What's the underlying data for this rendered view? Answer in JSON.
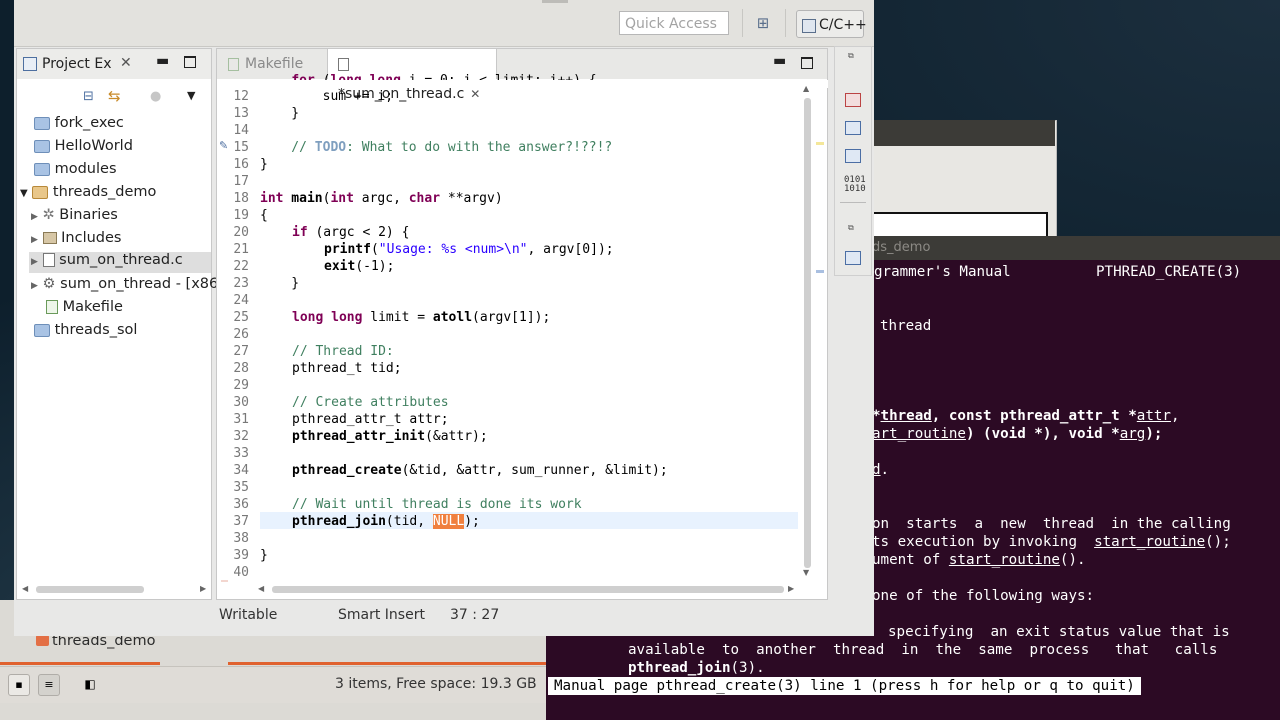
{
  "eclipse": {
    "quick_access_placeholder": "Quick Access",
    "perspective_label": "C/C++",
    "project_explorer": {
      "title": "Project Ex",
      "items": [
        {
          "label": "fork_exec"
        },
        {
          "label": "HelloWorld"
        },
        {
          "label": "modules"
        },
        {
          "label": "threads_demo"
        },
        {
          "label": "Binaries"
        },
        {
          "label": "Includes"
        },
        {
          "label": "sum_on_thread.c"
        },
        {
          "label": "sum_on_thread - [x86_"
        },
        {
          "label": "Makefile"
        },
        {
          "label": "threads_sol"
        }
      ]
    },
    "editor": {
      "tabs": [
        {
          "label": "Makefile"
        },
        {
          "label": "*sum_on_thread.c"
        }
      ],
      "line_numbers": [
        "12",
        "13",
        "14",
        "15",
        "16",
        "17",
        "18",
        "19",
        "20",
        "21",
        "22",
        "23",
        "24",
        "25",
        "26",
        "27",
        "28",
        "29",
        "30",
        "31",
        "32",
        "33",
        "34",
        "35",
        "36",
        "37",
        "38",
        "39",
        "40"
      ],
      "code": {
        "l12": "        sum += i;",
        "l13": "    }",
        "l15_prefix": "    // ",
        "l15_todo": "TODO",
        "l15_rest": ": What to do with the answer?!??!?",
        "l16": "}",
        "l18_kw1": "int",
        "l18_fn": " main",
        "l18_a": "(",
        "l18_kw2": "int",
        "l18_b": " argc, ",
        "l18_kw3": "char",
        "l18_c": " **argv)",
        "l19": "{",
        "l20_kw": "if",
        "l20_rest": " (argc < 2) {",
        "l21_fn": "printf",
        "l21_a": "(",
        "l21_str": "\"Usage: %s <num>\\n\"",
        "l21_rest": ", argv[0]);",
        "l22_fn": "exit",
        "l22_rest": "(-1);",
        "l23": "    }",
        "l25_kw": "long long",
        "l25_a": " limit = ",
        "l25_fn": "atoll",
        "l25_rest": "(argv[1]);",
        "l27": "// Thread ID:",
        "l28": "pthread_t tid;",
        "l30": "// Create attributes",
        "l31": "pthread_attr_t attr;",
        "l32_fn": "pthread_attr_init",
        "l32_rest": "(&attr);",
        "l34_fn": "pthread_create",
        "l34_rest": "(&tid, &attr, sum_runner, &limit);",
        "l36": "// Wait until thread is done its work",
        "l37_fn": "pthread_join",
        "l37_a": "(tid, ",
        "l37_sel": "NULL",
        "l37_rest": ");",
        "l39": "}"
      }
    },
    "status": {
      "mode": "Writable",
      "insert": "Smart Insert",
      "position": "37 : 27"
    }
  },
  "file_manager": {
    "item": "threads_demo",
    "status": "3 items, Free space: 19.3 GB"
  },
  "terminal": {
    "title": "ds_demo",
    "lines": {
      "header_left": "grammer's Manual",
      "header_right": "PTHREAD_CREATE(3)",
      "name": "thread",
      "syn1_a": "*",
      "syn1_b": "thread",
      "syn1_c": ", const pthread_attr_t *",
      "syn1_d": "attr",
      "syn1_e": ",",
      "syn2_a": "art_routine",
      "syn2_b": ") (void *), void *",
      "syn2_c": "arg",
      "syn2_d": ");",
      "syn3": "d",
      "syn3_dot": ".",
      "d1": "on  starts  a  new  thread  in the calling",
      "d2_a": "ts execution by invoking  ",
      "d2_b": "start_routine",
      "d2_c": "();",
      "d3_a": "ument of ",
      "d3_b": "start_routine",
      "d3_c": "().",
      "d4": "one of the following ways:",
      "d5": "specifying  an exit status value that is",
      "d6": "available  to  another  thread  in  the  same  process   that   calls",
      "d7_a": "pthread_join",
      "d7_b": "(3)."
    },
    "status_line": "Manual page pthread_create(3) line 1 (press h for help or q to quit)"
  }
}
